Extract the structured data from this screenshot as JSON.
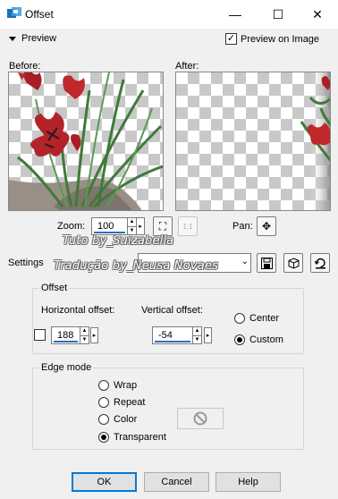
{
  "window": {
    "title": "Offset",
    "minimize_glyph": "—",
    "maximize_glyph": "☐",
    "close_glyph": "✕"
  },
  "preview": {
    "toggle_label": "Preview",
    "preview_on_image_label": "Preview on Image",
    "preview_on_image_checked": true,
    "before_label": "Before:",
    "after_label": "After:"
  },
  "zoom": {
    "label": "Zoom:",
    "value": "100",
    "pan_label": "Pan:"
  },
  "settings": {
    "label": "Settings",
    "preset_value": ""
  },
  "watermark": {
    "line1": "Tuto by_Suizabella",
    "line2": "Tradução by_Neusa Novaes"
  },
  "offset": {
    "group_title": "Offset",
    "horizontal_label": "Horizontal offset:",
    "horizontal_value": "188",
    "vertical_label": "Vertical offset:",
    "vertical_value": "-54",
    "center_label": "Center",
    "custom_label": "Custom",
    "selected": "Custom"
  },
  "edge_mode": {
    "group_title": "Edge mode",
    "options": [
      "Wrap",
      "Repeat",
      "Color",
      "Transparent"
    ],
    "selected": "Transparent"
  },
  "buttons": {
    "ok": "OK",
    "cancel": "Cancel",
    "help": "Help"
  },
  "colors": {
    "accent": "#0078d7",
    "field_underline": "#2d6cc0",
    "tulip_red": "#c0282b",
    "leaf_green": "#3f7a3a"
  }
}
